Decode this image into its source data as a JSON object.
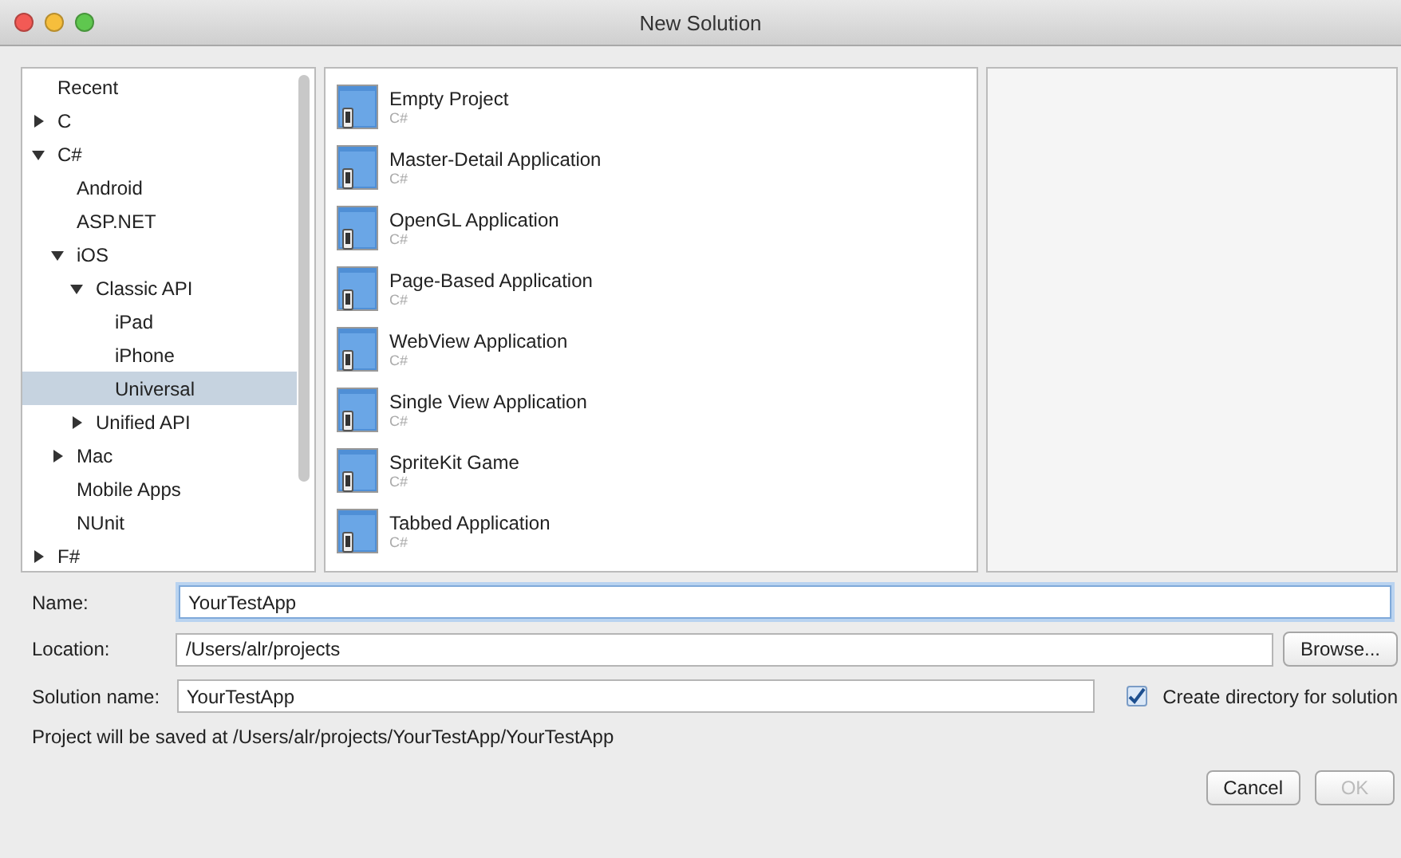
{
  "window": {
    "title": "New Solution"
  },
  "categories": [
    {
      "label": "Recent",
      "selected": false
    },
    {
      "label": "C",
      "selected": false,
      "expanded": false
    },
    {
      "label": "C#",
      "selected": false,
      "expanded": true,
      "children": [
        {
          "label": "Android",
          "selected": false
        },
        {
          "label": "ASP.NET",
          "selected": false
        },
        {
          "label": "iOS",
          "selected": false,
          "expanded": true,
          "children": [
            {
              "label": "Classic API",
              "selected": false,
              "expanded": true,
              "children": [
                {
                  "label": "iPad",
                  "selected": false
                },
                {
                  "label": "iPhone",
                  "selected": false
                },
                {
                  "label": "Universal",
                  "selected": true
                }
              ]
            },
            {
              "label": "Unified API",
              "selected": false,
              "expanded": false
            }
          ]
        },
        {
          "label": "Mac",
          "selected": false,
          "expanded": false
        },
        {
          "label": "Mobile Apps",
          "selected": false
        },
        {
          "label": "NUnit",
          "selected": false
        }
      ]
    },
    {
      "label": "F#",
      "selected": false,
      "expanded": false
    }
  ],
  "templates": [
    {
      "name": "Empty Project",
      "language": "C#",
      "selected": false
    },
    {
      "name": "Master-Detail Application",
      "language": "C#",
      "selected": false
    },
    {
      "name": "OpenGL Application",
      "language": "C#",
      "selected": false
    },
    {
      "name": "Page-Based Application",
      "language": "C#",
      "selected": false
    },
    {
      "name": "WebView Application",
      "language": "C#",
      "selected": false
    },
    {
      "name": "Single View Application",
      "language": "C#",
      "selected": false
    },
    {
      "name": "SpriteKit Game",
      "language": "C#",
      "selected": false
    },
    {
      "name": "Tabbed Application",
      "language": "C#",
      "selected": false
    }
  ],
  "form": {
    "name_label": "Name:",
    "name_value": "YourTestApp",
    "location_label": "Location:",
    "location_value": "/Users/alr/projects",
    "browse_button": "Browse...",
    "solution_label": "Solution name:",
    "solution_value": "YourTestApp",
    "create_directory": {
      "label": "Create directory for solution",
      "checked": true
    },
    "save_path": "Project will be saved at /Users/alr/projects/YourTestApp/YourTestApp"
  },
  "buttons": [
    {
      "label": "Cancel",
      "disabled": false
    },
    {
      "label": "OK",
      "disabled": true
    }
  ]
}
